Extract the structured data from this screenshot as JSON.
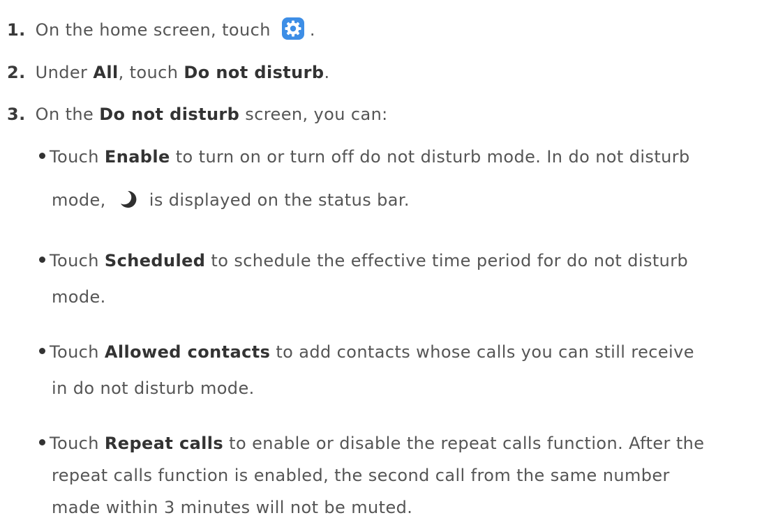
{
  "steps": [
    {
      "number": "1.",
      "before": "On the home screen, touch",
      "icon": "settings-gear-icon",
      "after": "."
    },
    {
      "number": "2.",
      "before": "Under",
      "bold1": "All",
      "middle": ", touch",
      "bold2": "Do not disturb",
      "after": "."
    },
    {
      "number": "3.",
      "before": "On the",
      "bold": "Do not disturb",
      "after": "screen, you can:"
    }
  ],
  "bullets": [
    {
      "prefix": "Touch",
      "bold": "Enable",
      "line1": "to turn on or turn off do not disturb mode. In do not disturb",
      "line2_before": "mode,",
      "line2_icon": "moon-icon",
      "line2_after": "is displayed on the status bar."
    },
    {
      "prefix": "Touch",
      "bold": "Scheduled",
      "line1": "to schedule the effective time period for do not disturb",
      "line2": "mode."
    },
    {
      "prefix": "Touch",
      "bold": "Allowed contacts",
      "line1": "to add contacts whose calls you can still receive",
      "line2": "in do not disturb mode."
    },
    {
      "prefix": "Touch",
      "bold": "Repeat calls",
      "line1": "to enable or disable the repeat calls function. After the",
      "line2": "repeat calls function is enabled, the second call from the same number",
      "line3": "made within 3 minutes will not be muted."
    }
  ],
  "colors": {
    "settings_icon": "#3d8ee6",
    "text": "#555555",
    "bold": "#333333"
  }
}
